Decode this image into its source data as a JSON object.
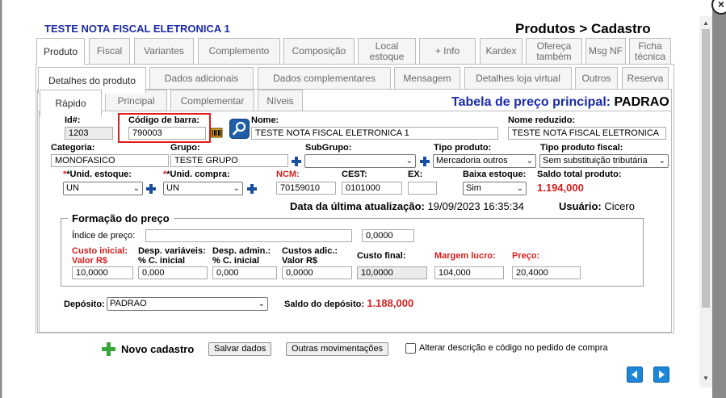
{
  "header": {
    "record_title": "TESTE NOTA FISCAL ELETRONICA 1",
    "page_title": "Produtos > Cadastro"
  },
  "tabs_main": [
    "Produto",
    "Fiscal",
    "Variantes",
    "Complemento",
    "Composição",
    "Local estoque",
    "+ Info",
    "Kardex",
    "Ofereça também",
    "Msg NF",
    "Ficha técnica"
  ],
  "tabs_sub": [
    "Detalhes do produto",
    "Dados adicionais",
    "Dados complementares",
    "Mensagem",
    "Detalhes loja virtual",
    "Outros",
    "Reserva"
  ],
  "tabs_detail": [
    "Rápido",
    "Principal",
    "Complementar",
    "Níveis"
  ],
  "price_table": {
    "label": "Tabela de preço principal:",
    "value": "PADRAO"
  },
  "fields": {
    "id_label": "Id#:",
    "id_value": "1203",
    "barcode_label": "Código de barra:",
    "barcode_value": "790003",
    "name_label": "Nome:",
    "name_value": "TESTE  NOTA FISCAL  ELETRONICA 1",
    "short_name_label": "Nome reduzido:",
    "short_name_value": "TESTE  NOTA FISCAL  ELETRONICA",
    "category_label": "Categoria:",
    "category_value": "MONOFASICO",
    "group_label": "Grupo:",
    "group_value": "TESTE GRUPO",
    "subgroup_label": "SubGrupo:",
    "subgroup_value": "",
    "product_type_label": "Tipo produto:",
    "product_type_value": "Mercadoria outros",
    "fiscal_type_label": "Tipo produto fiscal:",
    "fiscal_type_value": "Sem substituição tributária",
    "stock_unit_label": "*Unid. estoque:",
    "stock_unit_value": "UN",
    "purchase_unit_label": "*Unid. compra:",
    "purchase_unit_value": "UN",
    "ncm_label": "NCM:",
    "ncm_value": "70159010",
    "cest_label": "CEST:",
    "cest_value": "0101000",
    "ex_label": "EX:",
    "ex_value": "",
    "stock_down_label": "Baixa estoque:",
    "stock_down_value": "Sim",
    "total_balance_label": "Saldo total produto:",
    "total_balance_value": "1.194,000"
  },
  "update_info": {
    "date_label": "Data da última atualização:",
    "date_value": "19/09/2023 16:35:34",
    "user_label": "Usuário:",
    "user_value": "Cicero"
  },
  "pricing": {
    "legend": "Formação do preço",
    "index_label": "Índice de preço:",
    "index_value": "",
    "index_rate": "0,0000",
    "cols": [
      {
        "label1": "Custo inicial:",
        "label2": "Valor R$",
        "value": "10,0000",
        "red": true
      },
      {
        "label1": "Desp. variáveis:",
        "label2": "% C. inicial",
        "value": "0,000",
        "red": false
      },
      {
        "label1": "Desp. admin.:",
        "label2": "% C. inicial",
        "value": "0,000",
        "red": false
      },
      {
        "label1": "Custos adic.:",
        "label2": "Valor R$",
        "value": "0,0000",
        "red": false
      },
      {
        "label1": "Custo final:",
        "label2": "",
        "value": "10,0000",
        "red": false
      },
      {
        "label1": "Margem lucro:",
        "label2": "",
        "value": "104,000",
        "red": true
      },
      {
        "label1": "Preço:",
        "label2": "",
        "value": "20,4000",
        "red": true
      }
    ]
  },
  "deposit": {
    "label": "Depósito:",
    "value": "PADRAO",
    "balance_label": "Saldo do depósito:",
    "balance_value": "1.188,000"
  },
  "footer": {
    "new_label": "Novo cadastro",
    "save_label": "Salvar dados",
    "other_label": "Outras movimentações",
    "checkbox_label": "Alterar descrição e código no pedido de compra"
  },
  "colors": {
    "title_blue": "#1a2aa8",
    "accent_red": "#d61e1e",
    "plus_blue": "#1a4fa0",
    "nav_blue": "#1c86d8",
    "highlight_red": "#e21c1c"
  }
}
